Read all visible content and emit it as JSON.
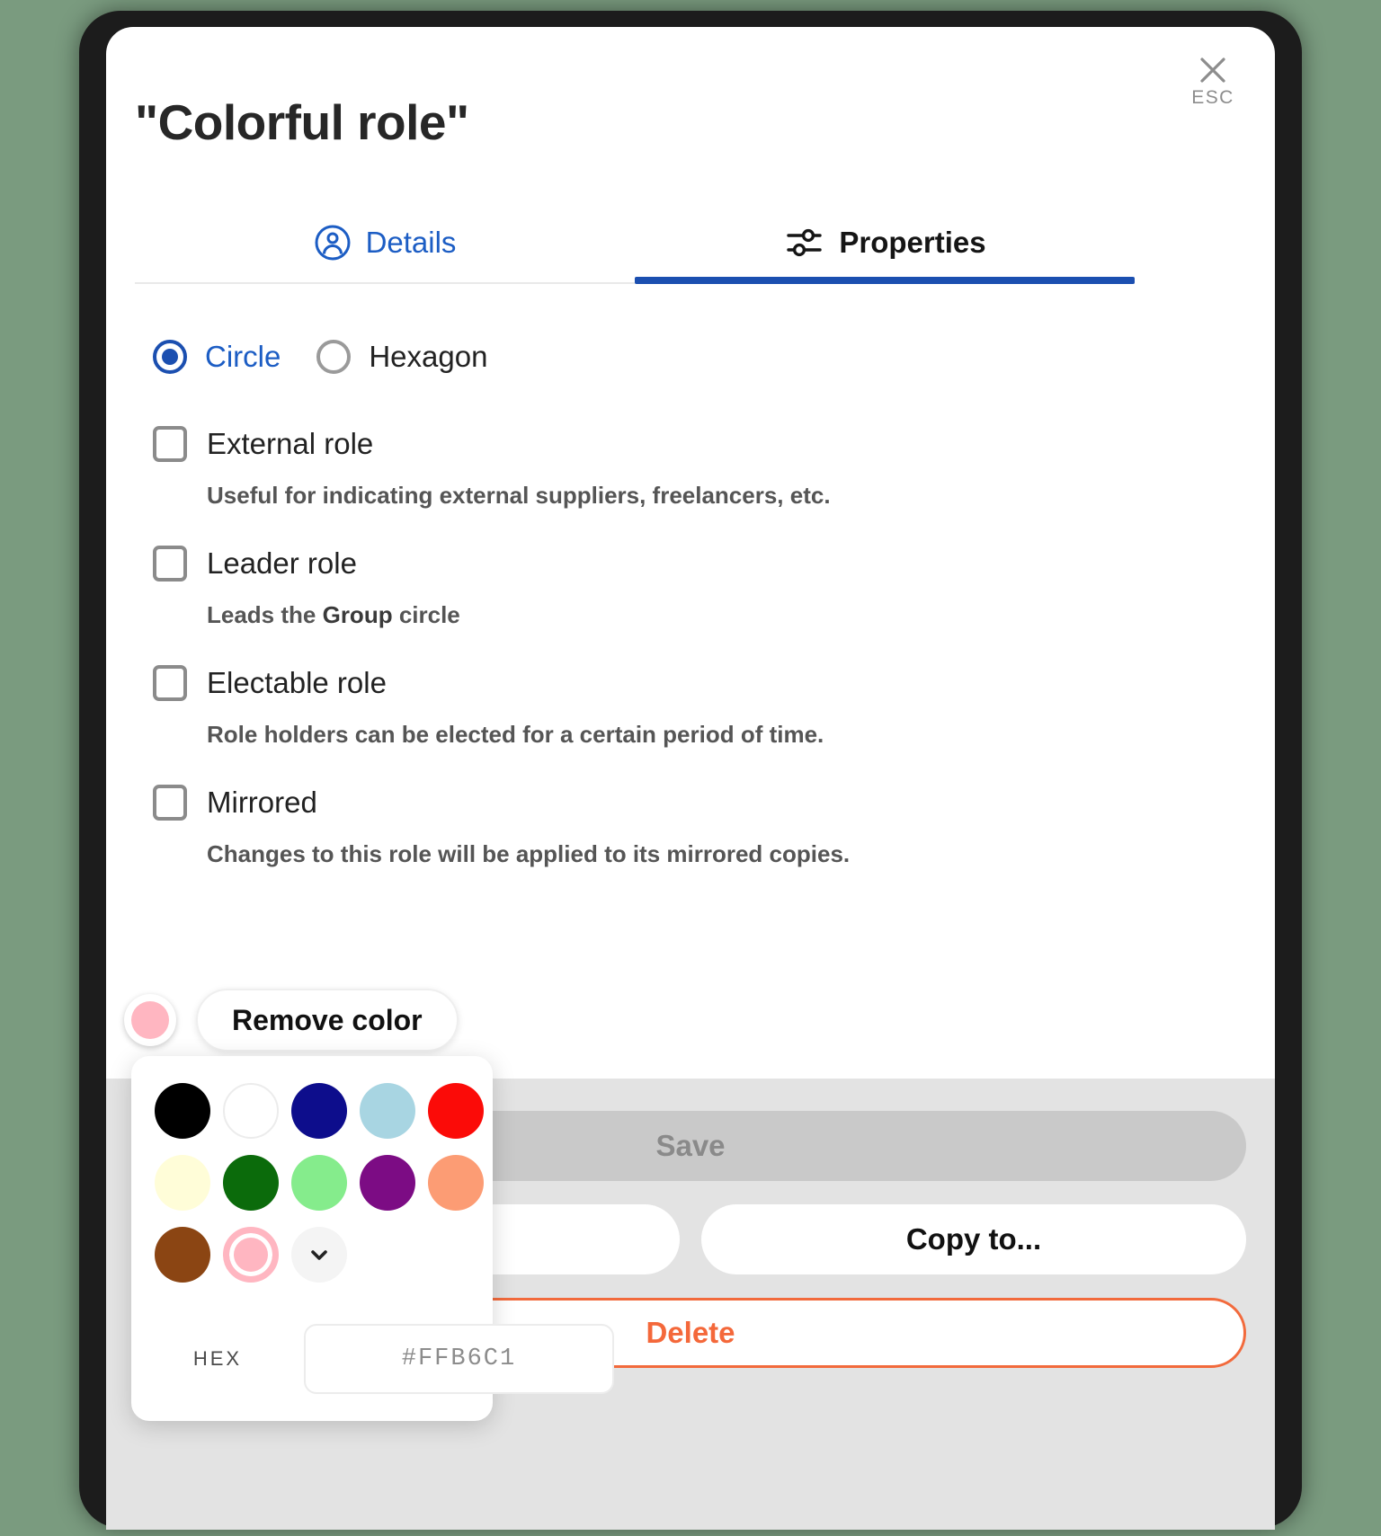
{
  "modal": {
    "title": "\"Colorful role\"",
    "close": {
      "label": "ESC",
      "icon": "close-icon"
    }
  },
  "tabs": [
    {
      "label": "Details",
      "icon": "user-circle-icon",
      "active": false
    },
    {
      "label": "Properties",
      "icon": "sliders-icon",
      "active": true
    }
  ],
  "shape": {
    "options": [
      {
        "label": "Circle",
        "selected": true
      },
      {
        "label": "Hexagon",
        "selected": false
      }
    ]
  },
  "checkboxes": [
    {
      "label": "External role",
      "checked": false,
      "help": "Useful for indicating external suppliers, freelancers, etc."
    },
    {
      "label": "Leader role",
      "checked": false,
      "help_prefix": "Leads the ",
      "help_bold": "Group",
      "help_suffix": " circle"
    },
    {
      "label": "Electable role",
      "checked": false,
      "help": "Role holders can be elected for a certain period of time."
    },
    {
      "label": "Mirrored",
      "checked": false,
      "help": "Changes to this role will be applied to its mirrored copies."
    }
  ],
  "color_control": {
    "current_color": "#FFB6C1",
    "remove_label": "Remove color"
  },
  "color_picker": {
    "swatches": [
      {
        "name": "black",
        "hex": "#000000",
        "selected": false
      },
      {
        "name": "white",
        "hex": "#FFFFFF",
        "selected": false
      },
      {
        "name": "navy",
        "hex": "#0D0D8C",
        "selected": false
      },
      {
        "name": "light-blue",
        "hex": "#A8D5E2",
        "selected": false
      },
      {
        "name": "red",
        "hex": "#FB0B08",
        "selected": false
      },
      {
        "name": "ivory",
        "hex": "#FFFDD8",
        "selected": false
      },
      {
        "name": "dark-green",
        "hex": "#0B6B0B",
        "selected": false
      },
      {
        "name": "light-green",
        "hex": "#85EC8C",
        "selected": false
      },
      {
        "name": "purple",
        "hex": "#7C0C84",
        "selected": false
      },
      {
        "name": "light-salmon",
        "hex": "#FC9C74",
        "selected": false
      },
      {
        "name": "brown",
        "hex": "#8B4513",
        "selected": false
      },
      {
        "name": "pink",
        "hex": "#FFB6C1",
        "selected": true
      }
    ],
    "more_icon": "chevron-down-icon",
    "hex_label": "HEX",
    "hex_value": "#FFB6C1",
    "hex_placeholder": "#FFB6C1"
  },
  "footer": {
    "save_label": "Save",
    "save_disabled": true,
    "secondary_label": "",
    "copy_to_label": "Copy to...",
    "delete_label": "Delete"
  },
  "colors": {
    "accent_blue": "#1b4fb0",
    "link_blue": "#1c5dc4",
    "delete_orange": "#f4683a",
    "footer_bg": "#e3e3e3",
    "save_disabled_bg": "#c9c9c9"
  }
}
